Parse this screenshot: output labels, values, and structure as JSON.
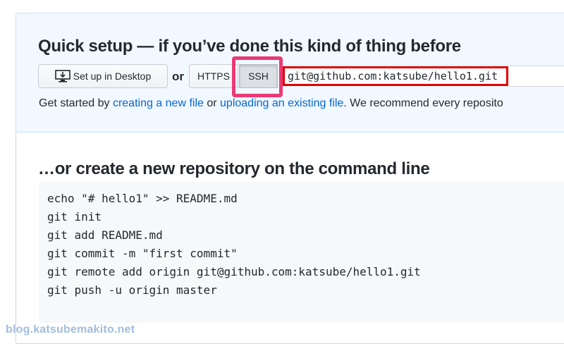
{
  "quick_setup": {
    "heading": "Quick setup — if you’ve done this kind of thing before",
    "desktop_button_label": "Set up in Desktop",
    "or_label": "or",
    "https_button_label": "HTTPS",
    "ssh_button_label": "SSH",
    "clone_url": "git@github.com:katsube/hello1.git",
    "help_prefix": "Get started by ",
    "help_link_1": "creating a new file",
    "help_middle": " or ",
    "help_link_2": "uploading an existing file",
    "help_suffix": ". We recommend every reposito"
  },
  "command_line": {
    "heading": "…or create a new repository on the command line",
    "lines": [
      "echo \"# hello1\" >> README.md",
      "git init",
      "git add README.md",
      "git commit -m \"first commit\"",
      "git remote add origin git@github.com:katsube/hello1.git",
      "git push -u origin master"
    ]
  },
  "watermark": "blog.katsubemakito.net",
  "colors": {
    "link": "#0366d6",
    "ssh_highlight": "#ea3a75",
    "url_highlight": "#e00000",
    "quick_bg": "#f1f8ff"
  }
}
